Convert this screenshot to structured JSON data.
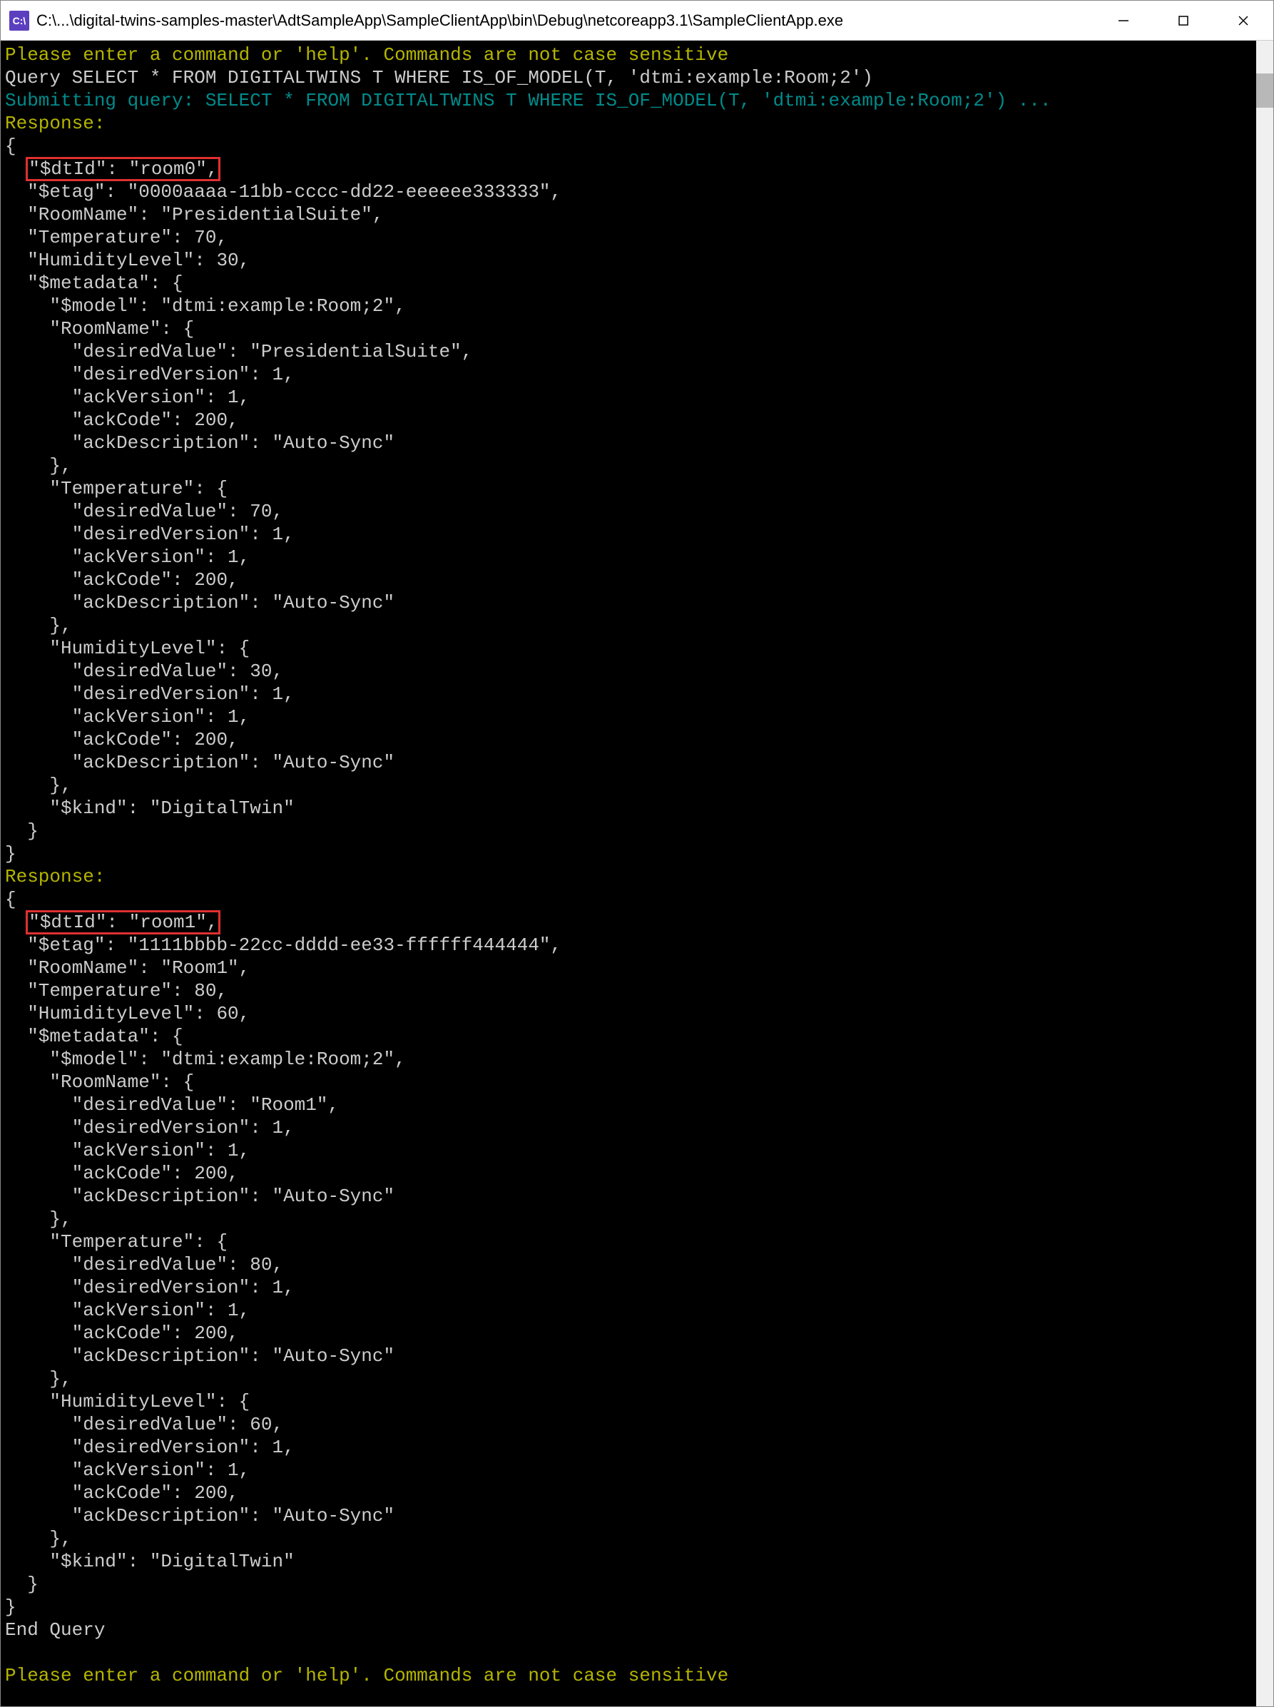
{
  "window": {
    "title": "C:\\...\\digital-twins-samples-master\\AdtSampleApp\\SampleClientApp\\bin\\Debug\\netcoreapp3.1\\SampleClientApp.exe",
    "icon_label": "C:\\"
  },
  "console": {
    "prompt1": "Please enter a command or 'help'. Commands are not case sensitive",
    "query_line": "Query SELECT * FROM DIGITALTWINS T WHERE IS_OF_MODEL(T, 'dtmi:example:Room;2')",
    "submitting": "Submitting query: SELECT * FROM DIGITALTWINS T WHERE IS_OF_MODEL(T, 'dtmi:example:Room;2') ...",
    "response_label": "Response:",
    "end_query": "End Query",
    "prompt2": "Please enter a command or 'help'. Commands are not case sensitive",
    "room0": {
      "dtid_line": "\"$dtId\": \"room0\",",
      "lines": [
        "{",
        "  \"$etag\": \"0000aaaa-11bb-cccc-dd22-eeeeee333333\",",
        "  \"RoomName\": \"PresidentialSuite\",",
        "  \"Temperature\": 70,",
        "  \"HumidityLevel\": 30,",
        "  \"$metadata\": {",
        "    \"$model\": \"dtmi:example:Room;2\",",
        "    \"RoomName\": {",
        "      \"desiredValue\": \"PresidentialSuite\",",
        "      \"desiredVersion\": 1,",
        "      \"ackVersion\": 1,",
        "      \"ackCode\": 200,",
        "      \"ackDescription\": \"Auto-Sync\"",
        "    },",
        "    \"Temperature\": {",
        "      \"desiredValue\": 70,",
        "      \"desiredVersion\": 1,",
        "      \"ackVersion\": 1,",
        "      \"ackCode\": 200,",
        "      \"ackDescription\": \"Auto-Sync\"",
        "    },",
        "    \"HumidityLevel\": {",
        "      \"desiredValue\": 30,",
        "      \"desiredVersion\": 1,",
        "      \"ackVersion\": 1,",
        "      \"ackCode\": 200,",
        "      \"ackDescription\": \"Auto-Sync\"",
        "    },",
        "    \"$kind\": \"DigitalTwin\"",
        "  }",
        "}"
      ]
    },
    "room1": {
      "dtid_line": "\"$dtId\": \"room1\",",
      "lines": [
        "{",
        "  \"$etag\": \"1111bbbb-22cc-dddd-ee33-ffffff444444\",",
        "  \"RoomName\": \"Room1\",",
        "  \"Temperature\": 80,",
        "  \"HumidityLevel\": 60,",
        "  \"$metadata\": {",
        "    \"$model\": \"dtmi:example:Room;2\",",
        "    \"RoomName\": {",
        "      \"desiredValue\": \"Room1\",",
        "      \"desiredVersion\": 1,",
        "      \"ackVersion\": 1,",
        "      \"ackCode\": 200,",
        "      \"ackDescription\": \"Auto-Sync\"",
        "    },",
        "    \"Temperature\": {",
        "      \"desiredValue\": 80,",
        "      \"desiredVersion\": 1,",
        "      \"ackVersion\": 1,",
        "      \"ackCode\": 200,",
        "      \"ackDescription\": \"Auto-Sync\"",
        "    },",
        "    \"HumidityLevel\": {",
        "      \"desiredValue\": 60,",
        "      \"desiredVersion\": 1,",
        "      \"ackVersion\": 1,",
        "      \"ackCode\": 200,",
        "      \"ackDescription\": \"Auto-Sync\"",
        "    },",
        "    \"$kind\": \"DigitalTwin\"",
        "  }",
        "}"
      ]
    }
  }
}
